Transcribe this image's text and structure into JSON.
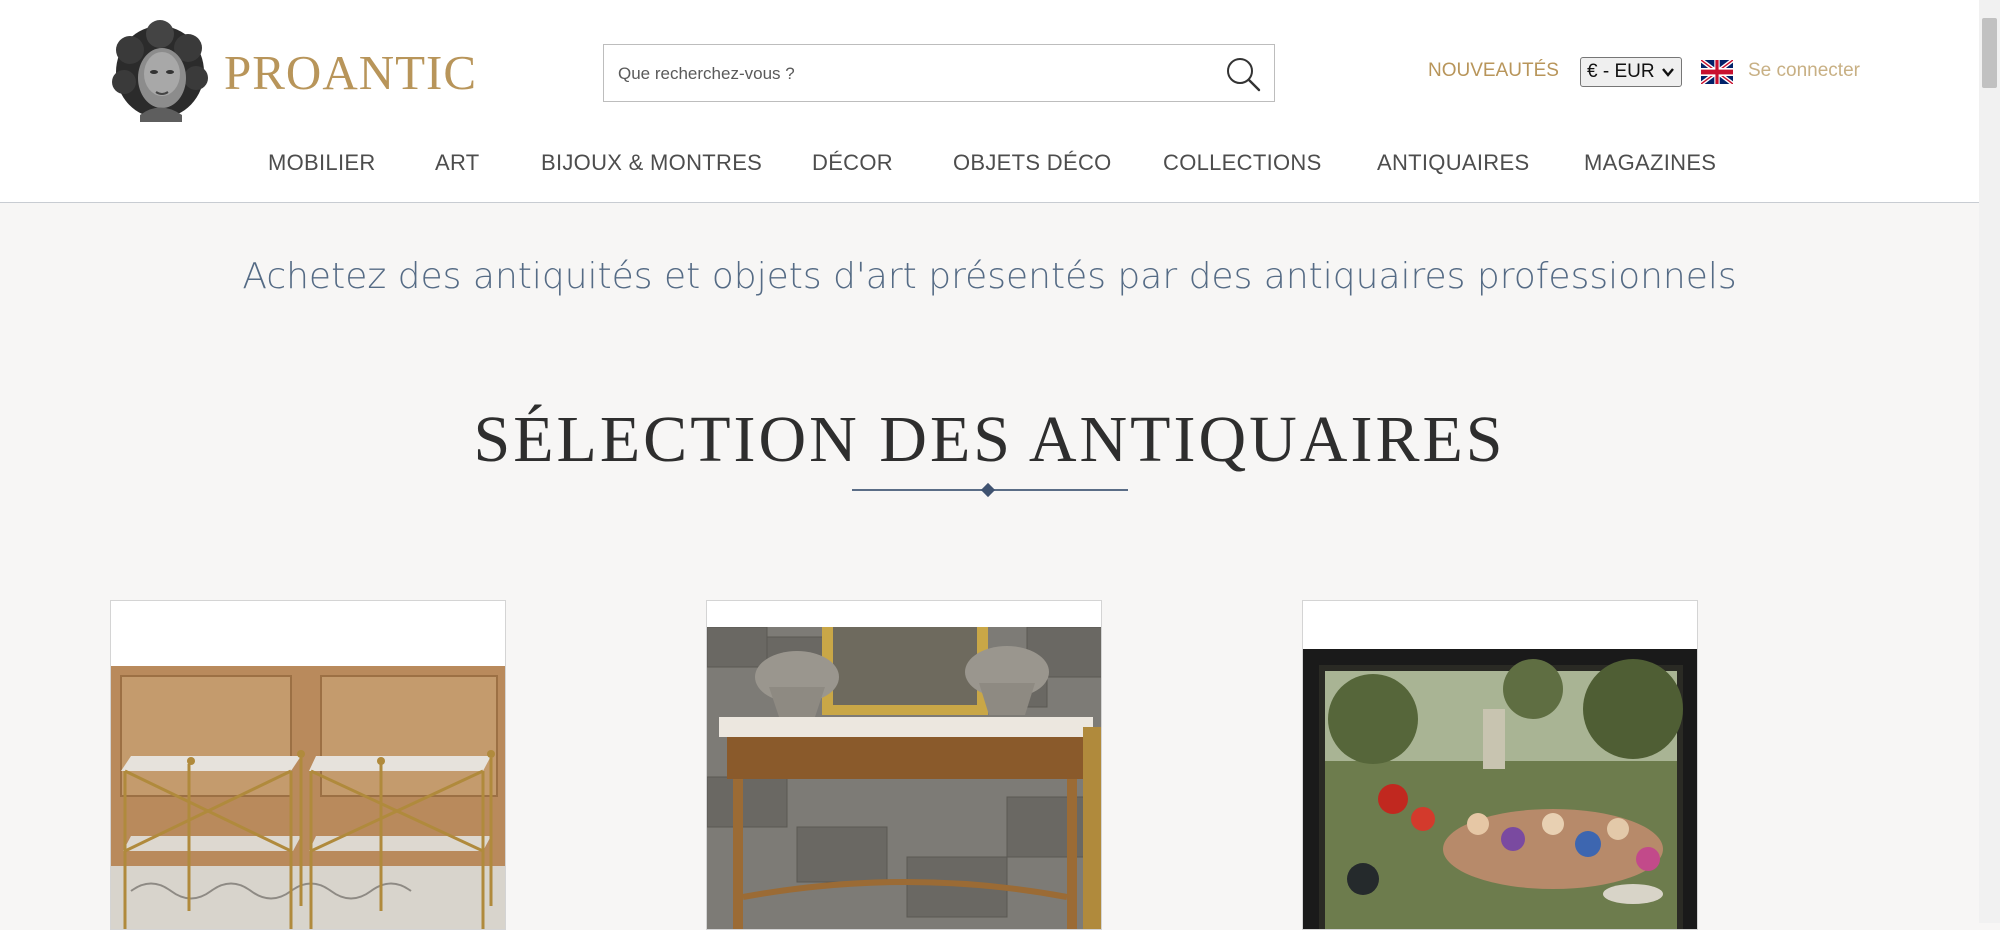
{
  "header": {
    "logo_text": "PROANTIC",
    "search": {
      "placeholder": "Que recherchez-vous ?",
      "value": ""
    },
    "nouveautes": "NOUVEAUTÉS",
    "currency": "€ - EUR",
    "language_flag": "uk-flag-icon",
    "login": "Se connecter"
  },
  "nav": {
    "items": [
      {
        "label": "MOBILIER"
      },
      {
        "label": "ART"
      },
      {
        "label": "BIJOUX & MONTRES"
      },
      {
        "label": "DÉCOR"
      },
      {
        "label": "OBJETS DÉCO"
      },
      {
        "label": "COLLECTIONS"
      },
      {
        "label": "ANTIQUAIRES"
      },
      {
        "label": "MAGAZINES"
      }
    ]
  },
  "main": {
    "tagline": "Achetez des antiquités et objets d'art présentés par des antiquaires professionnels",
    "section_title": "SÉLECTION DES ANTIQUAIRES",
    "cards": [
      {
        "image": "pair-of-brass-marble-side-tables"
      },
      {
        "image": "marble-top-console-with-mirror-and-stone-urns"
      },
      {
        "image": "framed-painting-fete-champetre"
      }
    ]
  },
  "colors": {
    "brand_gold": "#b8955a",
    "tagline_blue": "#556b85",
    "background": "#f7f6f5"
  }
}
